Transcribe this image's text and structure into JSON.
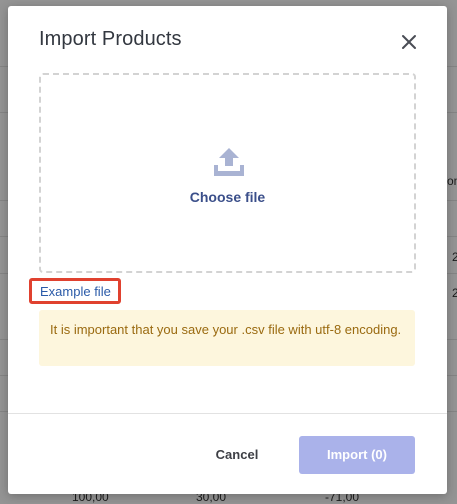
{
  "background": {
    "right_edge_text": [
      "on",
      "2",
      "2"
    ],
    "bottom_row": [
      "100,00",
      "30,00",
      "-71,00"
    ]
  },
  "modal": {
    "title": "Import Products",
    "close_icon": "close-icon",
    "dropzone": {
      "icon": "upload-icon",
      "label": "Choose file"
    },
    "example_link": "Example file",
    "warning": "It is important that you save your .csv file with utf-8 encoding.",
    "footer": {
      "cancel_label": "Cancel",
      "import_label": "Import (0)"
    }
  },
  "colors": {
    "accent": "#3b4f8a",
    "import_button_disabled": "#aab2ea",
    "warning_bg": "#fdf6dd",
    "warning_text": "#9a6a10",
    "highlight_border": "#e0412f",
    "link": "#2a5aa8"
  }
}
